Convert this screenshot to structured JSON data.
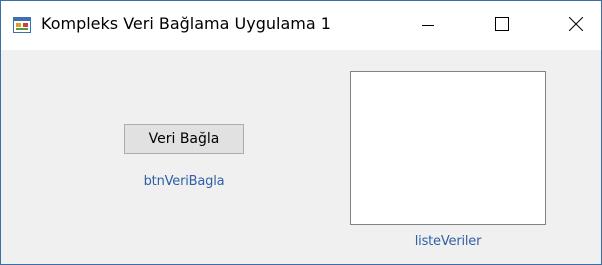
{
  "window": {
    "title": "Kompleks Veri Bağlama Uygulama 1",
    "icon": "winforms-app-icon",
    "controls": {
      "minimize": "minimize-icon",
      "maximize": "maximize-icon",
      "close": "close-icon"
    }
  },
  "form": {
    "button_label": "Veri Bağla",
    "button_name_caption": "btnVeriBagla",
    "listbox_name_caption": "listeVeriler"
  },
  "colors": {
    "caption_text": "#2f5fa5",
    "client_background": "#f0f0f0",
    "window_border": "#3a6ea5"
  }
}
